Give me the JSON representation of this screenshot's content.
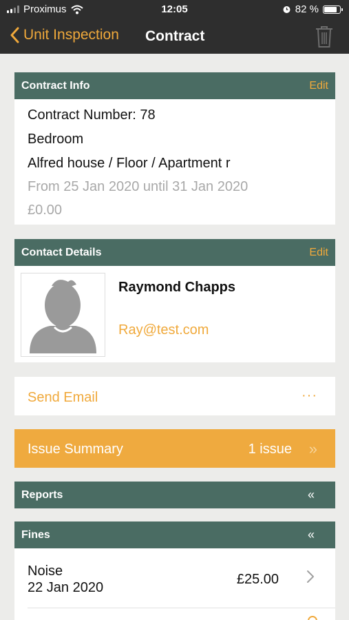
{
  "status_bar": {
    "carrier": "Proximus",
    "time": "12:05",
    "battery": "82 %",
    "battery_level": 0.82
  },
  "nav": {
    "back_label": "Unit Inspection",
    "title": "Contract",
    "trash_icon": "trash-icon"
  },
  "contract_info": {
    "header": "Contract Info",
    "edit_label": "Edit",
    "contract_number": "Contract Number: 78",
    "room": "Bedroom",
    "location": "Alfred house / Floor / Apartment r",
    "period": "From 25 Jan 2020 until 31 Jan 2020",
    "amount": "£0.00"
  },
  "contact_details": {
    "header": "Contact Details",
    "edit_label": "Edit",
    "name": "Raymond Chapps",
    "email": "Ray@test.com"
  },
  "actions": {
    "send_email": "Send Email",
    "more": "···"
  },
  "issue_summary": {
    "label": "Issue Summary",
    "count": "1 issue",
    "arrow": "»"
  },
  "reports": {
    "header": "Reports",
    "toggle": "«"
  },
  "fines": {
    "header": "Fines",
    "toggle": "«",
    "items": [
      {
        "type": "Noise",
        "date": "22 Jan 2020",
        "amount": "£25.00"
      }
    ]
  },
  "colors": {
    "accent": "#f0a93b",
    "header": "#4a6c63",
    "nav": "#2e2e2e",
    "issue_bar": "#efaa3f"
  }
}
